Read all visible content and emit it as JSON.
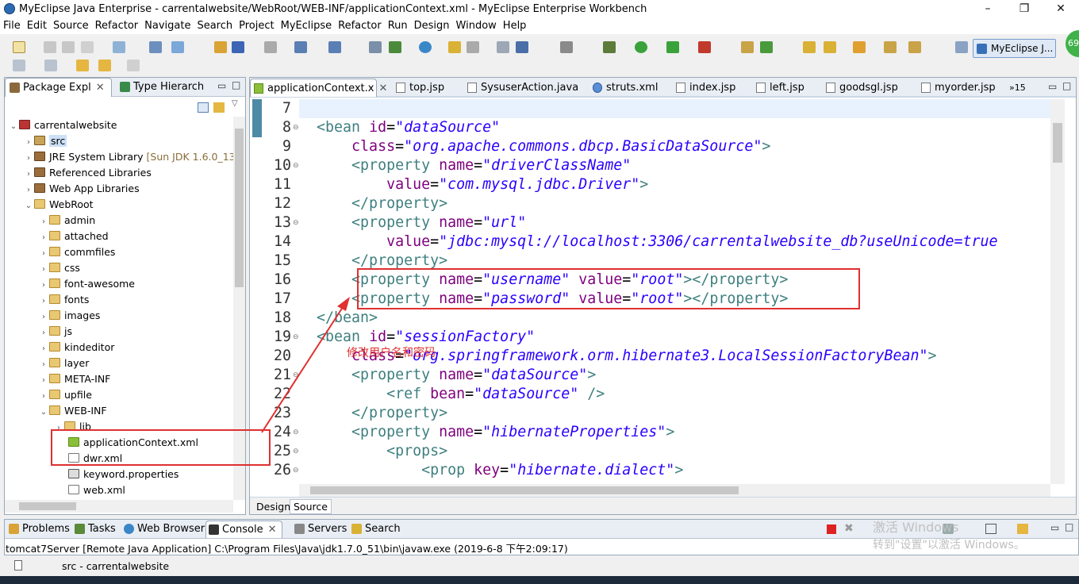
{
  "window": {
    "title": "MyEclipse Java Enterprise - carrentalwebsite/WebRoot/WEB-INF/applicationContext.xml - MyEclipse Enterprise Workbench",
    "minimize": "–",
    "maximize": "❐",
    "close": "✕"
  },
  "menu": [
    "File",
    "Edit",
    "Source",
    "Refactor",
    "Navigate",
    "Search",
    "Project",
    "MyEclipse",
    "Refactor",
    "Run",
    "Design",
    "Window",
    "Help"
  ],
  "perspective": {
    "label": "MyEclipse J..."
  },
  "badge": "69",
  "left_panel": {
    "tabs": [
      {
        "label": "Package Expl",
        "close": "✕"
      },
      {
        "label": "Type Hierarch"
      }
    ],
    "tree": [
      {
        "label": "carrentalwebsite",
        "icon": "project-icon"
      },
      {
        "label": "src",
        "icon": "source-folder-icon"
      },
      {
        "label": "JRE System Library",
        "suffix": "[Sun JDK 1.6.0_13]",
        "icon": "library-icon"
      },
      {
        "label": "Referenced Libraries",
        "icon": "library-icon"
      },
      {
        "label": "Web App Libraries",
        "icon": "library-icon"
      },
      {
        "label": "WebRoot",
        "icon": "folder-icon"
      },
      {
        "label": "admin",
        "icon": "folder-icon"
      },
      {
        "label": "attached",
        "icon": "folder-icon"
      },
      {
        "label": "commfiles",
        "icon": "folder-icon"
      },
      {
        "label": "css",
        "icon": "folder-icon"
      },
      {
        "label": "font-awesome",
        "icon": "folder-icon"
      },
      {
        "label": "fonts",
        "icon": "folder-icon"
      },
      {
        "label": "images",
        "icon": "folder-icon"
      },
      {
        "label": "js",
        "icon": "folder-icon"
      },
      {
        "label": "kindeditor",
        "icon": "folder-icon"
      },
      {
        "label": "layer",
        "icon": "folder-icon"
      },
      {
        "label": "META-INF",
        "icon": "folder-icon"
      },
      {
        "label": "upfile",
        "icon": "folder-icon"
      },
      {
        "label": "WEB-INF",
        "icon": "folder-icon"
      },
      {
        "label": "lib",
        "icon": "folder-icon"
      },
      {
        "label": "applicationContext.xml",
        "icon": "spring-leaf-icon"
      },
      {
        "label": "dwr.xml",
        "icon": "xml-file-icon"
      },
      {
        "label": "keyword.properties",
        "icon": "properties-file-icon"
      },
      {
        "label": "web.xml",
        "icon": "xml-file-icon"
      }
    ]
  },
  "editor": {
    "tabs": [
      {
        "label": "applicationContext.x",
        "close": "✕"
      },
      {
        "label": "top.jsp"
      },
      {
        "label": "SysuserAction.java"
      },
      {
        "label": "struts.xml"
      },
      {
        "label": "index.jsp"
      },
      {
        "label": "left.jsp"
      },
      {
        "label": "goodsgl.jsp"
      },
      {
        "label": "myorder.jsp"
      },
      {
        "label": "»15"
      }
    ],
    "line_numbers": [
      "7",
      "8",
      "9",
      "10",
      "11",
      "12",
      "13",
      "14",
      "15",
      "16",
      "17",
      "18",
      "19",
      "20",
      "21",
      "22",
      "23",
      "24",
      "25",
      "26"
    ],
    "bottom_tabs": [
      "Design",
      "Source"
    ]
  },
  "annotation": {
    "text": "修改用户名和密码"
  },
  "bottom_panel": {
    "tabs": [
      "Problems",
      "Tasks",
      "Web Browser",
      "Console",
      "Servers",
      "Search"
    ],
    "console_line": "tomcat7Server [Remote Java Application] C:\\Program Files\\Java\\jdk1.7.0_51\\bin\\javaw.exe (2019-6-8 下午2:09:17)"
  },
  "status": {
    "text": "src - carrentalwebsite"
  },
  "watermark": {
    "line1": "激活 Windows",
    "line2": "转到\"设置\"以激活 Windows。"
  }
}
